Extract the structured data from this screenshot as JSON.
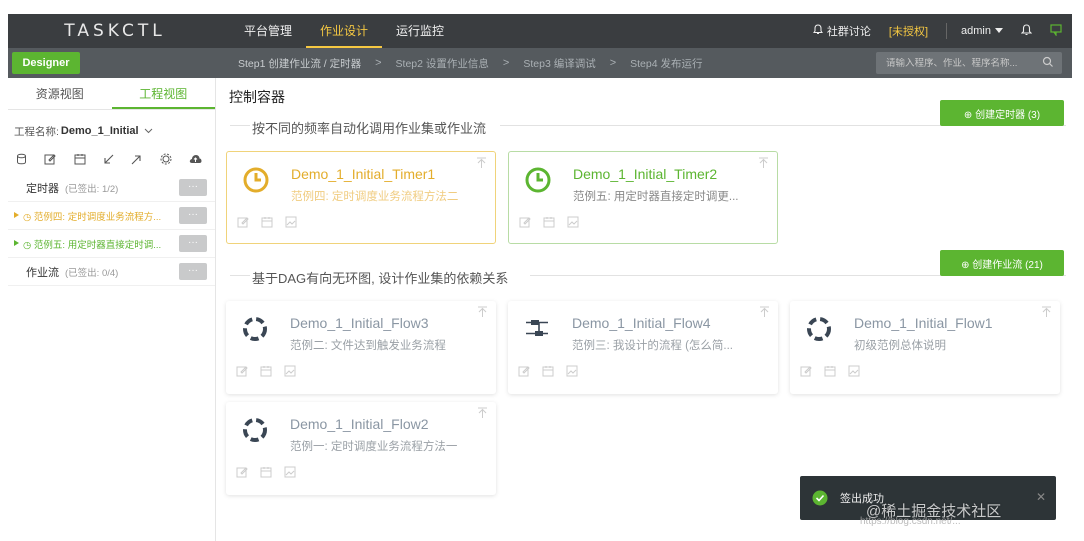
{
  "app": {
    "logo": "TASKCTL"
  },
  "topnav": {
    "items": [
      {
        "label": "平台管理"
      },
      {
        "label": "作业设计"
      },
      {
        "label": "运行监控"
      }
    ],
    "community": "社群讨论",
    "license": "[未授权]",
    "user": "admin"
  },
  "subbar": {
    "designer_label": "Designer",
    "steps": [
      "Step1 创建作业流 / 定时器",
      "Step2 设置作业信息",
      "Step3 编译调试",
      "Step4 发布运行"
    ],
    "search_placeholder": "请输入程序、作业、程序名称..."
  },
  "sidebar": {
    "tabs": [
      {
        "label": "资源视图"
      },
      {
        "label": "工程视图"
      }
    ],
    "project_label": "工程名称:",
    "project_name": "Demo_1_Initial",
    "tree": [
      {
        "label": "定时器",
        "count": "(已签出: 1/2)"
      },
      {
        "label": "◷ 范例四: 定时调度业务流程方..."
      },
      {
        "label": "◷ 范例五: 用定时器直接定时调..."
      },
      {
        "label": "作业流",
        "count": "(已签出: 0/4)"
      }
    ],
    "more_label": "···"
  },
  "main": {
    "title": "控制容器",
    "timer_section": "按不同的频率自动化调用作业集或作业流",
    "timer_create": "⊕ 创建定时器 (3)",
    "flow_section": "基于DAG有向无环图, 设计作业集的依赖关系",
    "flow_create": "⊕ 创建作业流 (21)",
    "timers": [
      {
        "title": "Demo_1_Initial_Timer1",
        "desc": "范例四: 定时调度业务流程方法二",
        "color": "#e3ad2b"
      },
      {
        "title": "Demo_1_Initial_Timer2",
        "desc": "范例五: 用定时器直接定时调更...",
        "color": "#5cb531"
      }
    ],
    "flows": [
      {
        "title": "Demo_1_Initial_Flow3",
        "desc": "范例二: 文件达到触发业务流程"
      },
      {
        "title": "Demo_1_Initial_Flow4",
        "desc": "范例三: 我设计的流程 (怎么简..."
      },
      {
        "title": "Demo_1_Initial_Flow1",
        "desc": "初级范例总体说明"
      },
      {
        "title": "Demo_1_Initial_Flow2",
        "desc": "范例一: 定时调度业务流程方法一"
      }
    ]
  },
  "toast": {
    "message": "签出成功"
  },
  "watermark": {
    "text": "@稀土掘金技术社区",
    "url": "https://blog.csdn.net/..."
  },
  "colors": {
    "accent": "#5cb531",
    "warning": "#e3ad2b",
    "topbar": "#3a3d40"
  }
}
